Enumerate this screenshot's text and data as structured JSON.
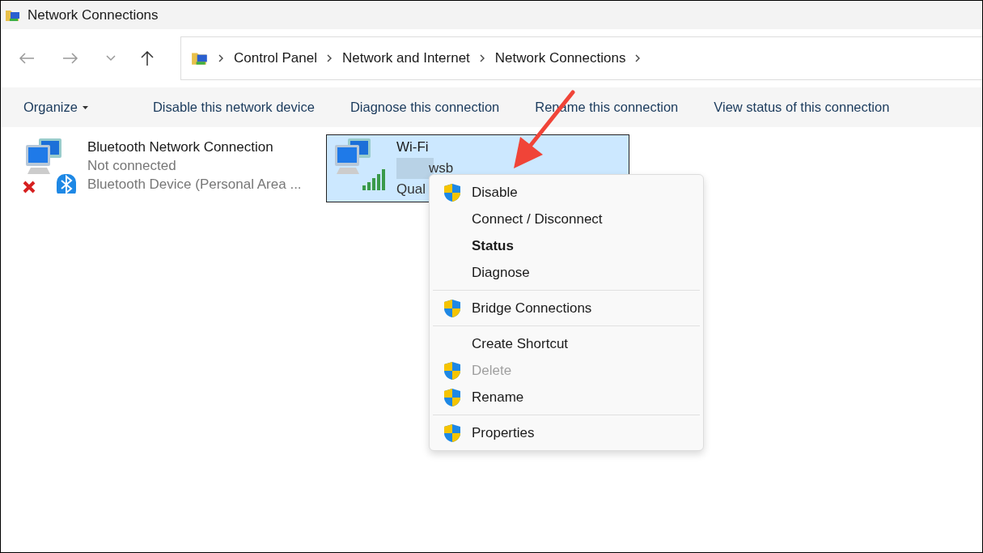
{
  "window": {
    "title": "Network Connections"
  },
  "breadcrumb": [
    "Control Panel",
    "Network and Internet",
    "Network Connections"
  ],
  "commands": [
    {
      "label": "Organize",
      "dropdown": true
    },
    {
      "label": "Disable this network device",
      "dropdown": false
    },
    {
      "label": "Diagnose this connection",
      "dropdown": false
    },
    {
      "label": "Rename this connection",
      "dropdown": false
    },
    {
      "label": "View status of this connection",
      "dropdown": false
    }
  ],
  "connections": [
    {
      "kind": "bluetooth",
      "name": "Bluetooth Network Connection",
      "status": "Not connected",
      "device": "Bluetooth Device (Personal Area ...",
      "selected": false,
      "connected": false
    },
    {
      "kind": "wifi",
      "name": "Wi-Fi",
      "status": "wsb",
      "device": "Qual",
      "selected": true,
      "connected": true
    }
  ],
  "context_menu": [
    {
      "kind": "item",
      "label": "Disable",
      "shield": true,
      "bold": false,
      "disabled": false
    },
    {
      "kind": "item",
      "label": "Connect / Disconnect",
      "shield": false,
      "bold": false,
      "disabled": false
    },
    {
      "kind": "item",
      "label": "Status",
      "shield": false,
      "bold": true,
      "disabled": false
    },
    {
      "kind": "item",
      "label": "Diagnose",
      "shield": false,
      "bold": false,
      "disabled": false
    },
    {
      "kind": "separator"
    },
    {
      "kind": "item",
      "label": "Bridge Connections",
      "shield": true,
      "bold": false,
      "disabled": false
    },
    {
      "kind": "separator"
    },
    {
      "kind": "item",
      "label": "Create Shortcut",
      "shield": false,
      "bold": false,
      "disabled": false
    },
    {
      "kind": "item",
      "label": "Delete",
      "shield": true,
      "bold": false,
      "disabled": true
    },
    {
      "kind": "item",
      "label": "Rename",
      "shield": true,
      "bold": false,
      "disabled": false
    },
    {
      "kind": "separator"
    },
    {
      "kind": "item",
      "label": "Properties",
      "shield": true,
      "bold": false,
      "disabled": false
    }
  ]
}
